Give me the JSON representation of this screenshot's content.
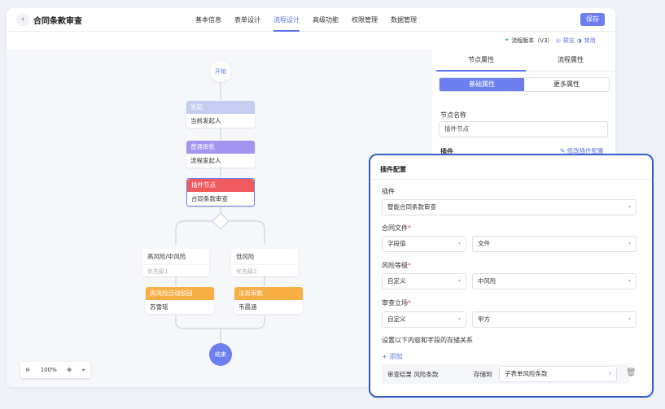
{
  "header": {
    "back_icon": "chevron-left-icon",
    "title": "合同条款审查",
    "tabs": [
      {
        "label": "基本信息",
        "active": false
      },
      {
        "label": "表单设计",
        "active": false
      },
      {
        "label": "流程设计",
        "active": true
      },
      {
        "label": "高级功能",
        "active": false
      },
      {
        "label": "权限管理",
        "active": false
      },
      {
        "label": "数据管理",
        "active": false
      }
    ],
    "save_label": "保存"
  },
  "version_bar": {
    "version": "流程版本（V3）",
    "preview": "预览",
    "disable": "禁用"
  },
  "flow": {
    "start": "开始",
    "end": "结束",
    "nodes": [
      {
        "header": "发起",
        "body": "当前发起人",
        "color": "#c3cdf0"
      },
      {
        "header": "普通审批",
        "body": "流程发起人",
        "color": "#a394ef"
      },
      {
        "header": "插件节点",
        "body": "合同条款审查",
        "color": "#f05a5e"
      }
    ],
    "branches": [
      {
        "title": "高风险/中风险",
        "priority": "优先级1",
        "task_header": "高风险自动驳回",
        "task_body": "苏雪瑶"
      },
      {
        "title": "低风险",
        "priority": "优先级2",
        "task_header": "法务审批",
        "task_body": "韦晨涵"
      }
    ],
    "branch_task_color": "#f6ae45",
    "accent_color": "#6d7ff0"
  },
  "zoom": {
    "level": "100%"
  },
  "panel": {
    "tabs": [
      {
        "label": "节点属性",
        "active": true
      },
      {
        "label": "流程属性",
        "active": false
      }
    ],
    "segments": [
      {
        "label": "基础属性",
        "active": true
      },
      {
        "label": "更多属性",
        "active": false
      }
    ],
    "node_name_label": "节点名称",
    "node_name_value": "插件节点",
    "plugin_label": "插件",
    "edit_plugin_link": "修改插件配置"
  },
  "plugin_config": {
    "title": "插件配置",
    "plugin_label": "插件",
    "plugin_value": "智能合同条款审查",
    "contract_file_label": "合同文件",
    "contract_file_type": "字段值",
    "contract_file_value": "文件",
    "risk_level_label": "风险等级",
    "risk_level_type": "自定义",
    "risk_level_value": "中风险",
    "stance_label": "审查立场",
    "stance_type": "自定义",
    "stance_value": "甲方",
    "mapping_label": "设置以下内容和字段的存储关系",
    "add_link": "+ 添加",
    "mapping_source": "审查结果 风险条款",
    "mapping_store_to": "存储到",
    "mapping_target": "子表单风险条款",
    "required_mark": "*"
  }
}
